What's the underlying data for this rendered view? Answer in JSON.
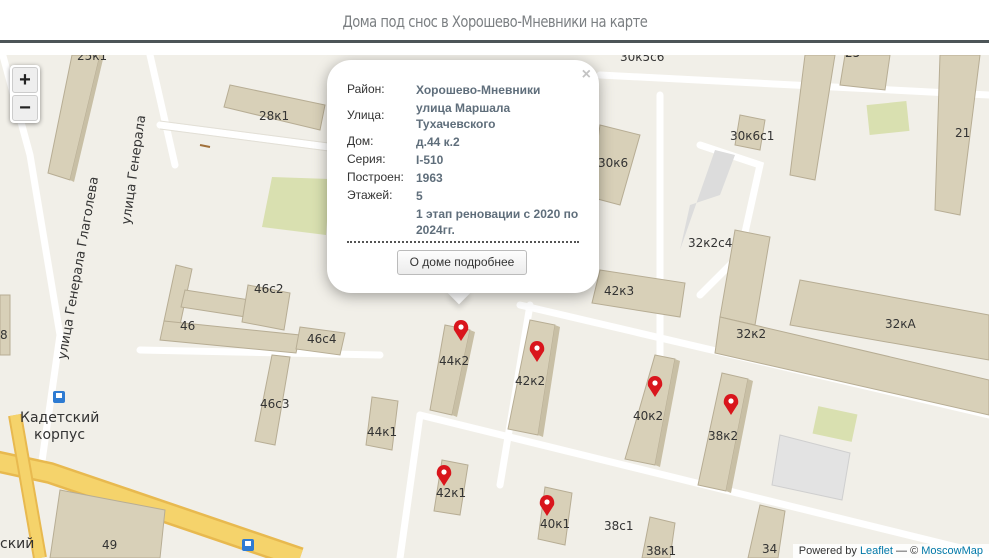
{
  "page": {
    "title": "Дома под снос в Хорошево-Мневники на карте"
  },
  "map": {
    "zoom_in": "+",
    "zoom_out": "−",
    "labels": {
      "l25k1": "25к1",
      "l28k1": "28к1",
      "l30k5s6": "30к5с6",
      "l25": "25",
      "l30k6s1": "30к6с1",
      "l30k6": "30к6",
      "l21": "21",
      "l32k2s4": "32к2с4",
      "l42k3": "42к3",
      "l32k2": "32к2",
      "l32kA": "32кА",
      "l46s2": "46с2",
      "l46": "46",
      "l46s4": "46с4",
      "l46s3": "46с3",
      "l8": "8",
      "l44k2": "44к2",
      "l42k2": "42к2",
      "l40k2": "40к2",
      "l38k2": "38к2",
      "l44k1": "44к1",
      "l42k1": "42к1",
      "l40k1": "40к1",
      "l38s1": "38с1",
      "l38k1": "38к1",
      "l34": "34",
      "l49": "49",
      "kadet1": "Кадетский",
      "kadet2": "корпус",
      "kadet_left": "ский",
      "street1": "улица Генерала Глаголева",
      "street2": "улица Генерала"
    },
    "attribution": {
      "prefix": "Powered by ",
      "leaflet": "Leaflet",
      "sep": " — © ",
      "moscowmap": "MoscowMap"
    }
  },
  "popup": {
    "close": "×",
    "rows": [
      {
        "label": "Район:",
        "value": "Хорошево-Мневники"
      },
      {
        "label": "Улица:",
        "value": "улица Маршала Тухачевского"
      },
      {
        "label": "Дом:",
        "value": "д.44 к.2"
      },
      {
        "label": "Серия:",
        "value": "I-510"
      },
      {
        "label": "Построен:",
        "value": "1963"
      },
      {
        "label": "Этажей:",
        "value": "5"
      },
      {
        "label": "",
        "value": "1 этап реновации с 2020 по 2024гг."
      }
    ],
    "button": "О доме подробнее"
  },
  "colors": {
    "road_major": "#f5d36b",
    "building": "#d8d0b8",
    "marker": "#d9151c",
    "park": "#d9e0b0"
  }
}
